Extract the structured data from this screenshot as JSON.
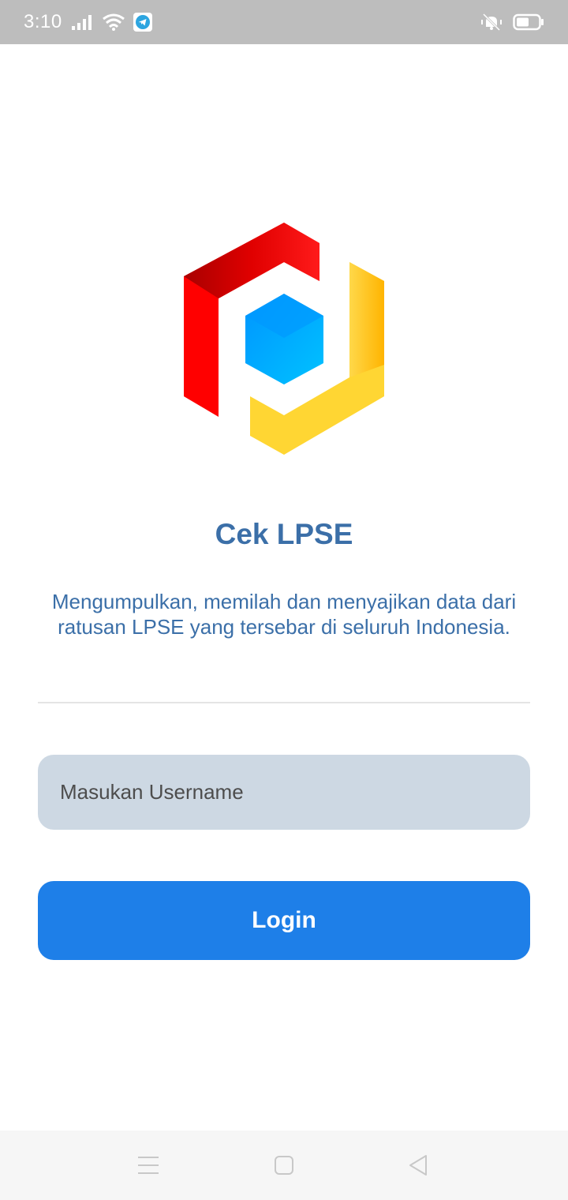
{
  "status_bar": {
    "time": "3:10",
    "icons_left": [
      "signal-icon",
      "wifi-icon",
      "telegram-icon"
    ],
    "icons_right": [
      "vibrate-icon",
      "battery-icon"
    ]
  },
  "app": {
    "title": "Cek LPSE",
    "description": "Mengumpulkan, memilah dan menyajikan data dari ratusan LPSE yang tersebar di seluruh Indonesia.",
    "logo_colors": {
      "red": "#ff0000",
      "yellow": "#ffd633",
      "blue": "#00a8ff"
    }
  },
  "form": {
    "username_placeholder": "Masukan Username",
    "username_value": "",
    "login_label": "Login"
  },
  "colors": {
    "accent": "#1e7fe8",
    "title_text": "#3b6fa8",
    "input_bg": "#cdd8e3"
  },
  "nav_bar": {
    "buttons": [
      "menu-icon",
      "home-icon",
      "back-icon"
    ]
  }
}
